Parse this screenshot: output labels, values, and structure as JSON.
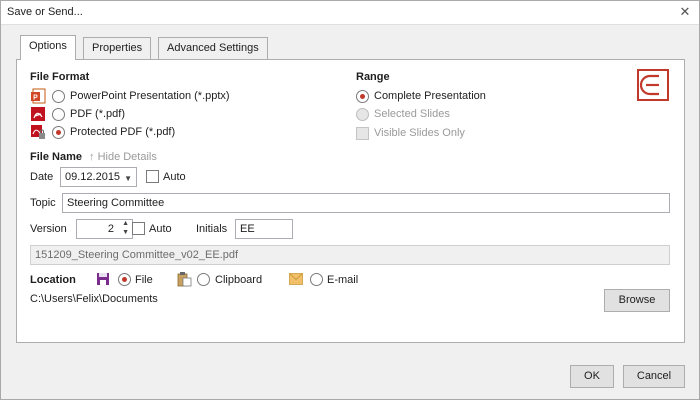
{
  "window": {
    "title": "Save or Send...",
    "close_glyph": "✕"
  },
  "tabs": [
    {
      "label": "Options",
      "active": true
    },
    {
      "label": "Properties",
      "active": false
    },
    {
      "label": "Advanced Settings",
      "active": false
    }
  ],
  "file_format": {
    "heading": "File Format",
    "options": [
      {
        "label": "PowerPoint Presentation (*.pptx)",
        "selected": false,
        "icon": "pptx-icon"
      },
      {
        "label": "PDF (*.pdf)",
        "selected": false,
        "icon": "pdf-icon"
      },
      {
        "label": "Protected PDF (*.pdf)",
        "selected": true,
        "icon": "protected-pdf-icon"
      }
    ]
  },
  "range": {
    "heading": "Range",
    "options": [
      {
        "label": "Complete Presentation",
        "selected": true,
        "enabled": true
      },
      {
        "label": "Selected Slides",
        "selected": false,
        "enabled": false
      }
    ],
    "visible_only": {
      "label": "Visible Slides Only",
      "checked": false,
      "enabled": false
    }
  },
  "file_name": {
    "heading": "File Name",
    "hide_details": "Hide Details",
    "date_label": "Date",
    "date_value": "09.12.2015",
    "date_auto_label": "Auto",
    "topic_label": "Topic",
    "topic_value": "Steering Committee",
    "version_label": "Version",
    "version_value": "2",
    "version_auto_label": "Auto",
    "initials_label": "Initials",
    "initials_value": "EE",
    "generated_name": "151209_Steering Committee_v02_EE.pdf"
  },
  "location": {
    "heading": "Location",
    "options": [
      {
        "label": "File",
        "selected": true,
        "icon": "save-file-icon"
      },
      {
        "label": "Clipboard",
        "selected": false,
        "icon": "clipboard-icon"
      },
      {
        "label": "E-mail",
        "selected": false,
        "icon": "email-icon"
      }
    ],
    "path": "C:\\Users\\Felix\\Documents",
    "browse_label": "Browse"
  },
  "buttons": {
    "ok": "OK",
    "cancel": "Cancel"
  },
  "colors": {
    "accent": "#c0392b",
    "brand_logo": "#c0392b"
  }
}
